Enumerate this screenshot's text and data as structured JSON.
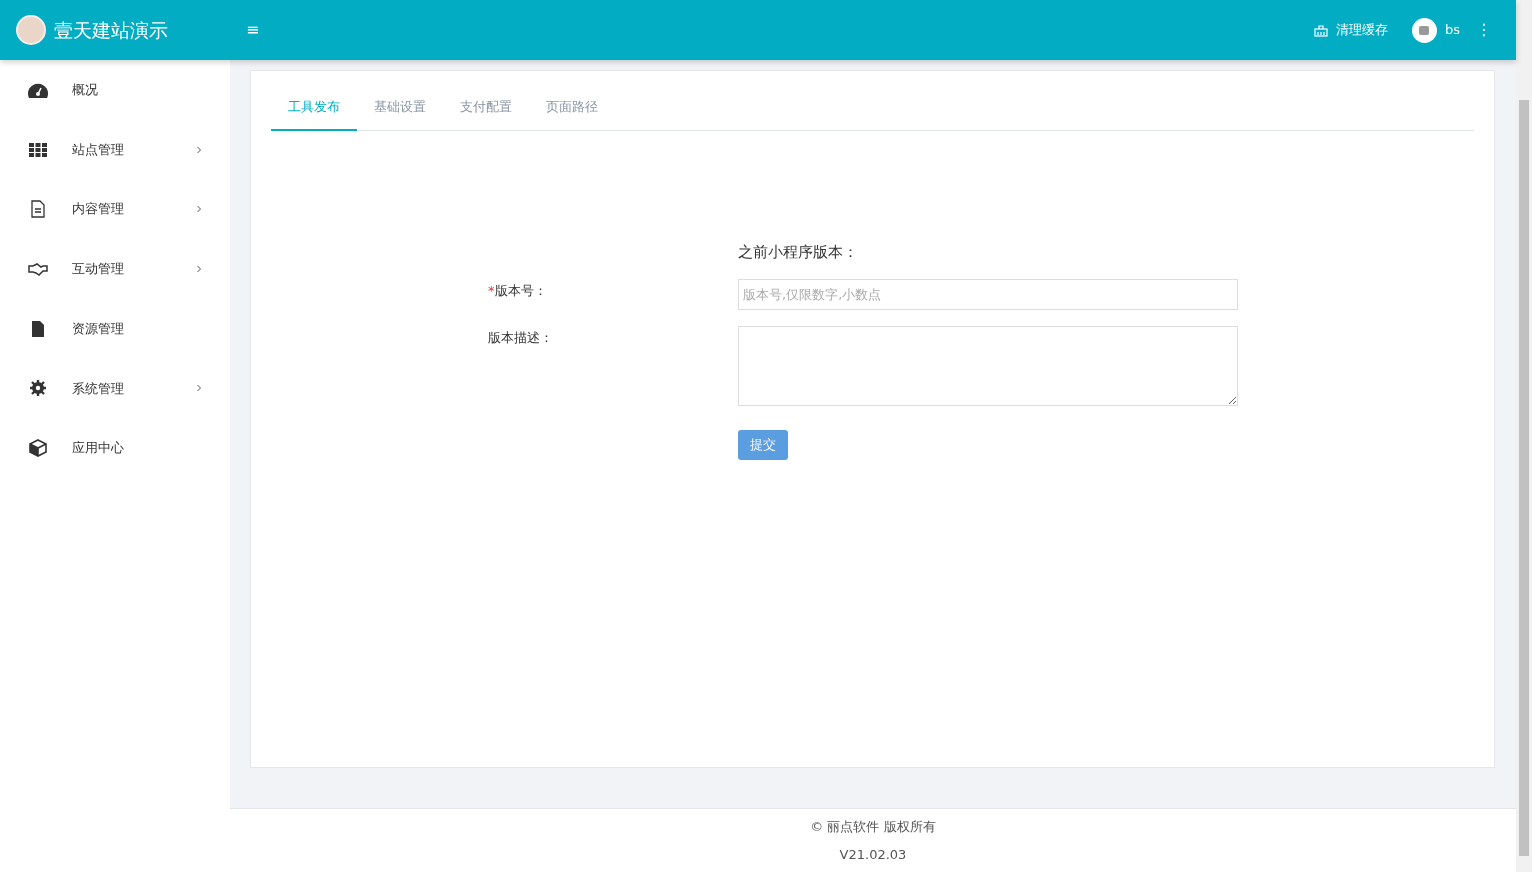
{
  "header": {
    "brand": "壹天建站演示",
    "menu_toggle": "≡",
    "clear_cache": "清理缓存",
    "user": "bs",
    "more": "⋮"
  },
  "sidebar": {
    "items": [
      {
        "label": "概况",
        "has_submenu": false
      },
      {
        "label": "站点管理",
        "has_submenu": true
      },
      {
        "label": "内容管理",
        "has_submenu": true
      },
      {
        "label": "互动管理",
        "has_submenu": true
      },
      {
        "label": "资源管理",
        "has_submenu": false
      },
      {
        "label": "系统管理",
        "has_submenu": true
      },
      {
        "label": "应用中心",
        "has_submenu": false
      }
    ]
  },
  "tabs": [
    {
      "label": "工具发布",
      "selected": true
    },
    {
      "label": "基础设置",
      "selected": false
    },
    {
      "label": "支付配置",
      "selected": false
    },
    {
      "label": "页面路径",
      "selected": false
    }
  ],
  "form": {
    "previous_version": "之前小程序版本：",
    "fields": [
      {
        "kind": "input",
        "required_mark": "*",
        "label": "版本号：",
        "placeholder": "版本号,仅限数字,小数点"
      },
      {
        "kind": "textarea",
        "label": "版本描述："
      }
    ],
    "submit": "提交"
  },
  "footer": {
    "copyright": "© 丽点软件 版权所有",
    "version": "V21.02.03"
  }
}
